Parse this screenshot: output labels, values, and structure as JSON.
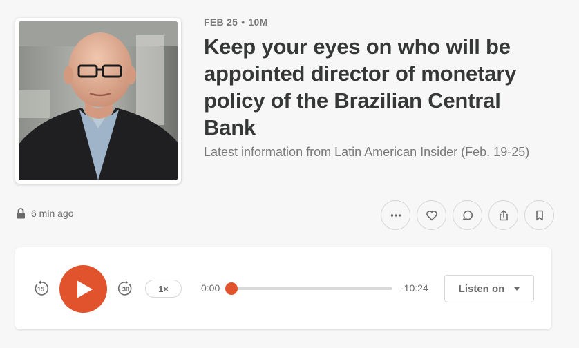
{
  "episode": {
    "date": "FEB 25",
    "separator": "•",
    "duration": "10M",
    "title": "Keep your eyes on who will be appointed director of monetary policy of the Brazilian Central Bank",
    "subtitle": "Latest information from Latin American Insider (Feb. 19-25)",
    "cover_icon": "cover-portrait"
  },
  "status": {
    "posted_ago": "6 min ago",
    "icon": "lock-icon"
  },
  "actions": [
    {
      "name": "more",
      "icon": "more-icon"
    },
    {
      "name": "like",
      "icon": "heart-icon"
    },
    {
      "name": "comment",
      "icon": "comment-icon"
    },
    {
      "name": "share",
      "icon": "share-icon"
    },
    {
      "name": "bookmark",
      "icon": "bookmark-icon"
    }
  ],
  "player": {
    "skip_back_seconds": "15",
    "skip_forward_seconds": "30",
    "speed_label": "1×",
    "current_time": "0:00",
    "remaining_time": "-10:24",
    "progress": 0,
    "listen_on_label": "Listen on",
    "accent_color": "#e0532d"
  }
}
